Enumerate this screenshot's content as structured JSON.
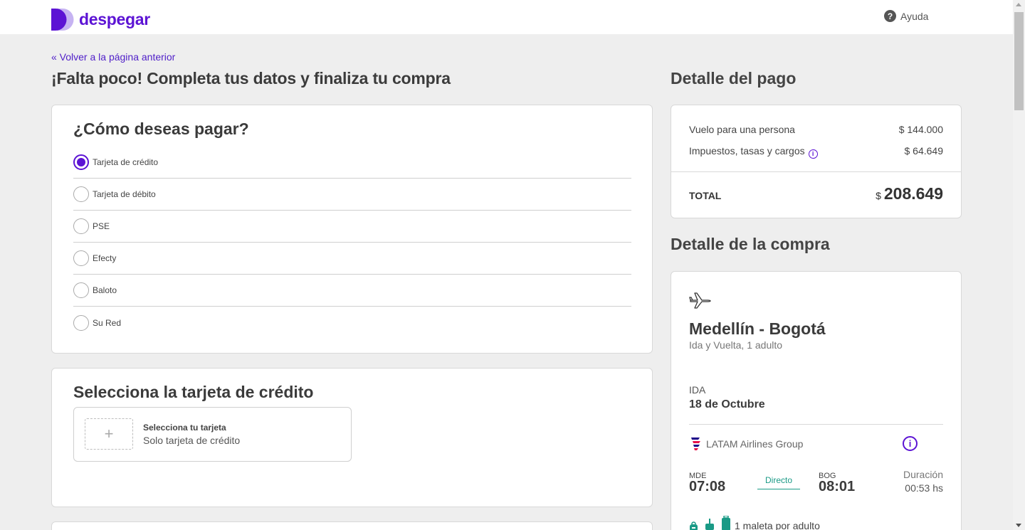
{
  "header": {
    "logo_text": "despegar",
    "help_label": "Ayuda"
  },
  "back_link": "« Volver a la página anterior",
  "page_title": "¡Falta poco! Completa tus datos y finaliza tu compra",
  "payment": {
    "title": "¿Cómo deseas pagar?",
    "options": [
      {
        "label": "Tarjeta de crédito",
        "selected": true
      },
      {
        "label": "Tarjeta de débito",
        "selected": false
      },
      {
        "label": "PSE",
        "selected": false
      },
      {
        "label": "Efecty",
        "selected": false
      },
      {
        "label": "Baloto",
        "selected": false
      },
      {
        "label": "Su Red",
        "selected": false
      }
    ]
  },
  "credit_card": {
    "title": "Selecciona la tarjeta de crédito",
    "select_label": "Selecciona tu tarjeta",
    "select_sub": "Solo tarjeta de crédito",
    "plus_symbol": "+"
  },
  "payment_detail": {
    "title": "Detalle del pago",
    "rows": [
      {
        "label": "Vuelo para una persona",
        "value": "$ 144.000"
      },
      {
        "label": "Impuestos, tasas y cargos",
        "value": "$ 64.649"
      }
    ],
    "total_label": "TOTAL",
    "total_currency": "$",
    "total_value": "208.649"
  },
  "purchase_detail": {
    "title": "Detalle de la compra",
    "route": "Medellín - Bogotá",
    "route_sub": "Ida y Vuelta, 1 adulto",
    "leg_label": "IDA",
    "leg_date": "18 de Octubre",
    "airline": "LATAM Airlines Group",
    "origin_code": "MDE",
    "origin_time": "07:08",
    "stops": "Directo",
    "dest_code": "BOG",
    "dest_time": "08:01",
    "duration_label": "Duración",
    "duration_value": "00:53 hs",
    "baggage_text": "1 maleta por adulto"
  },
  "colors": {
    "brand": "#5c13d4",
    "accent_teal": "#1a9a86",
    "background": "#eeeeee"
  },
  "icons": [
    "logo-mark-icon",
    "help-icon",
    "info-icon",
    "plane-icon",
    "latam-logo-icon",
    "backpack-icon",
    "carry-on-icon",
    "suitcase-icon"
  ]
}
